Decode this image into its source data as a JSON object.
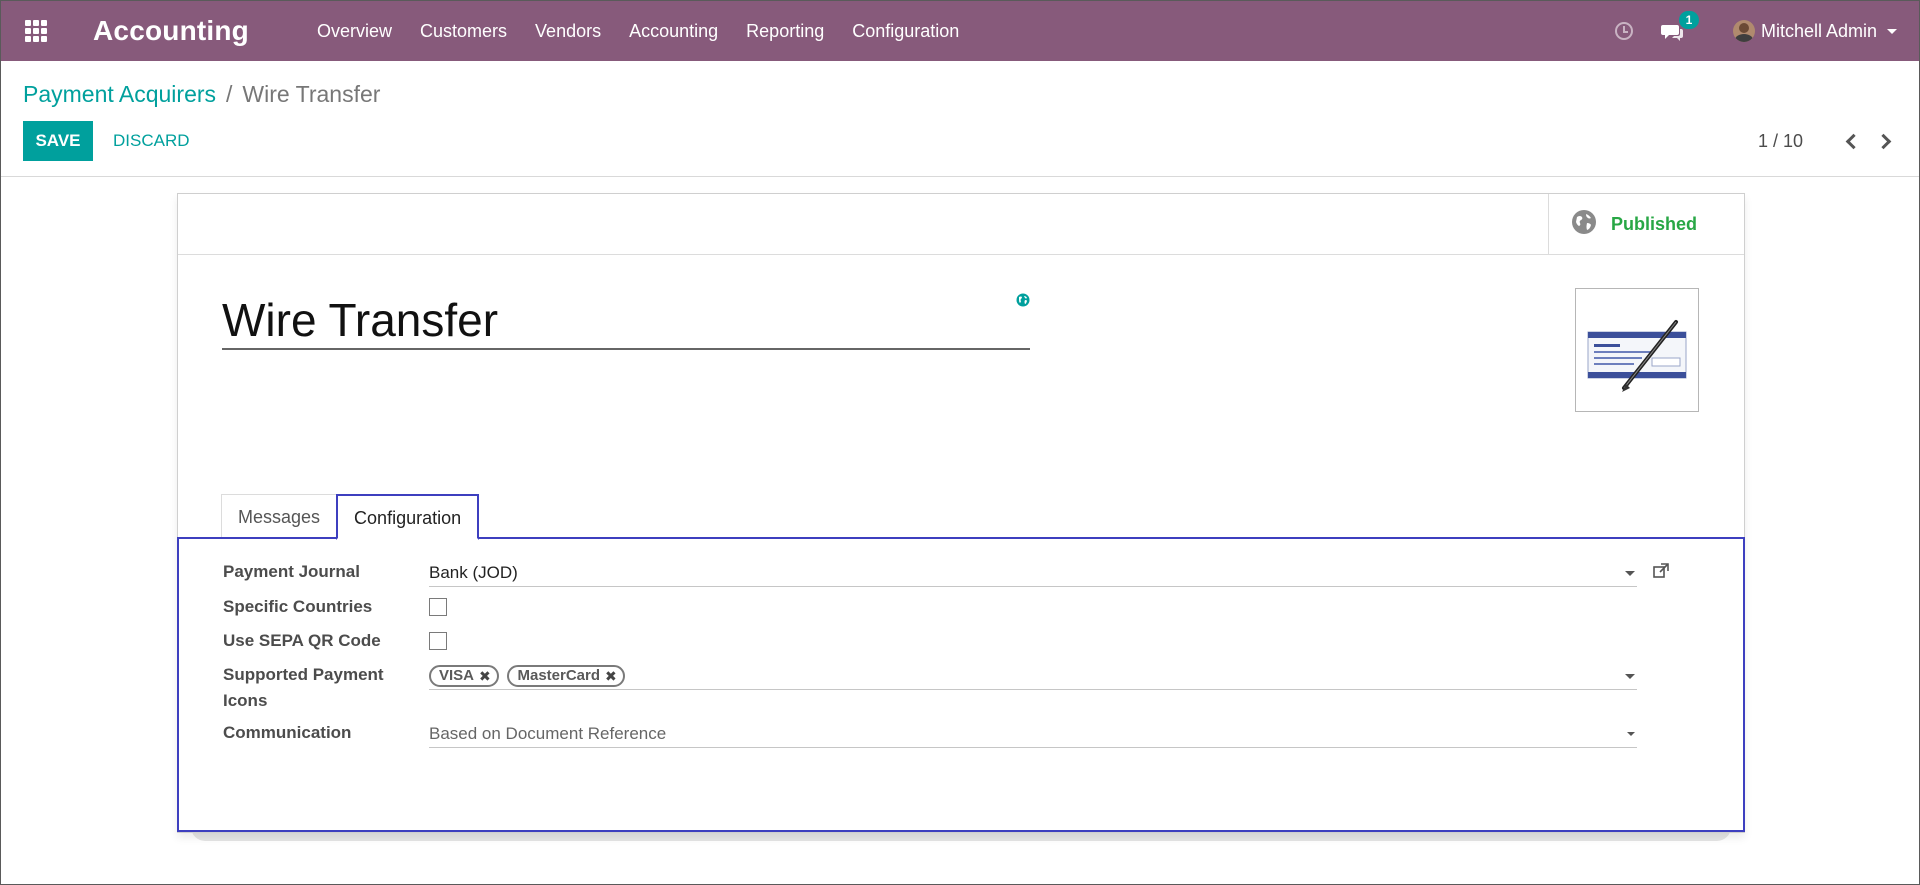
{
  "navbar": {
    "app_title": "Accounting",
    "menu": [
      "Overview",
      "Customers",
      "Vendors",
      "Accounting",
      "Reporting",
      "Configuration"
    ],
    "chat_badge": "1",
    "user_name": "Mitchell Admin",
    "background_color": "#875a7b"
  },
  "breadcrumb": {
    "parent": "Payment Acquirers",
    "separator": "/",
    "current": "Wire Transfer"
  },
  "actions": {
    "save_label": "SAVE",
    "discard_label": "DISCARD"
  },
  "pager": {
    "value": "1 / 10"
  },
  "form": {
    "status_button": "Published",
    "name": "Wire Transfer",
    "tabs": [
      {
        "label": "Messages",
        "active": false
      },
      {
        "label": "Configuration",
        "active": true
      }
    ],
    "fields": {
      "payment_journal": {
        "label": "Payment Journal",
        "value": "Bank (JOD)"
      },
      "specific_countries": {
        "label": "Specific Countries",
        "checked": false
      },
      "use_sepa_qr": {
        "label": "Use SEPA QR Code",
        "checked": false
      },
      "supported_icons": {
        "label_line1": "Supported Payment",
        "label_line2": "Icons",
        "tags": [
          "VISA",
          "MasterCard"
        ]
      },
      "communication": {
        "label": "Communication",
        "value": "Based on Document Reference"
      }
    }
  },
  "colors": {
    "primary": "#00a09d",
    "published": "#28a745",
    "focus_border": "#3d3fbf"
  }
}
